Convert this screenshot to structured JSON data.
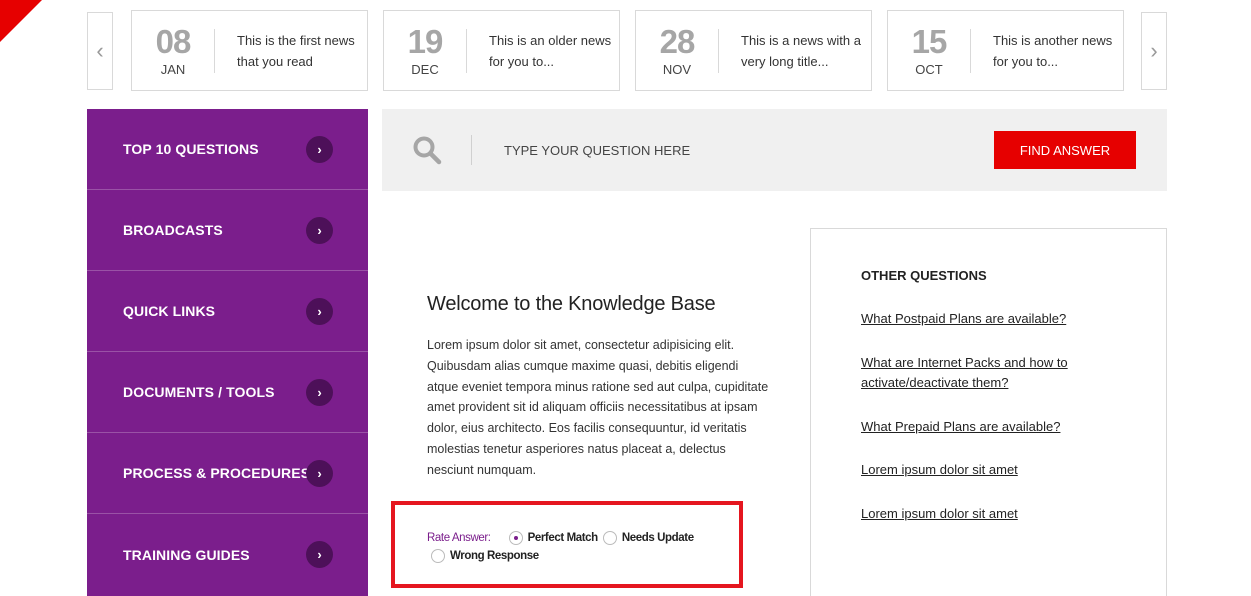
{
  "news": {
    "prev_icon": "chevron-left-icon",
    "next_icon": "chevron-right-icon",
    "prev_glyph": "‹",
    "next_glyph": "›",
    "items": [
      {
        "day": "08",
        "month": "JAN",
        "text": "This is the first news that you read"
      },
      {
        "day": "19",
        "month": "DEC",
        "text": "This is an older news for you to..."
      },
      {
        "day": "28",
        "month": "NOV",
        "text": "This is a news with a very long title..."
      },
      {
        "day": "15",
        "month": "OCT",
        "text": "This is another news for you to..."
      }
    ]
  },
  "sidebar": {
    "chevron_icon": "chevron-right-icon",
    "chevron_glyph": "›",
    "items": [
      {
        "label": "TOP 10 QUESTIONS"
      },
      {
        "label": "BROADCASTS"
      },
      {
        "label": "QUICK LINKS"
      },
      {
        "label": "DOCUMENTS / TOOLS"
      },
      {
        "label": "PROCESS & PROCEDURES"
      },
      {
        "label": "TRAINING GUIDES"
      }
    ]
  },
  "search": {
    "icon": "search-icon",
    "placeholder": "TYPE YOUR QUESTION HERE",
    "button_label": "FIND ANSWER"
  },
  "article": {
    "title": "Welcome to the Knowledge Base",
    "body": "Lorem ipsum dolor sit amet, consectetur adipisicing elit. Quibusdam alias cumque maxime quasi, debitis eligendi atque eveniet tempora minus ratione sed aut culpa, cupiditate amet provident sit id aliquam officiis necessitatibus at ipsam dolor, eius architecto. Eos facilis consequuntur, id veritatis molestias tenetur asperiores natus placeat a, delectus nesciunt numquam."
  },
  "rate": {
    "label": "Rate Answer:",
    "selected": "Perfect Match",
    "options": [
      "Perfect Match",
      "Needs Update",
      "Wrong Response"
    ]
  },
  "other_questions": {
    "title": "OTHER QUESTIONS",
    "links": [
      "What Postpaid Plans are available?",
      "What are Internet Packs and how to activate/deactivate them?",
      "What Prepaid Plans are available?",
      "Lorem ipsum dolor sit amet",
      "Lorem ipsum dolor sit amet"
    ]
  },
  "colors": {
    "brand_red": "#e60000",
    "sidebar_purple": "#7b1e8c",
    "chevron_circle": "#4d1059",
    "highlight_red": "#e5161f"
  }
}
